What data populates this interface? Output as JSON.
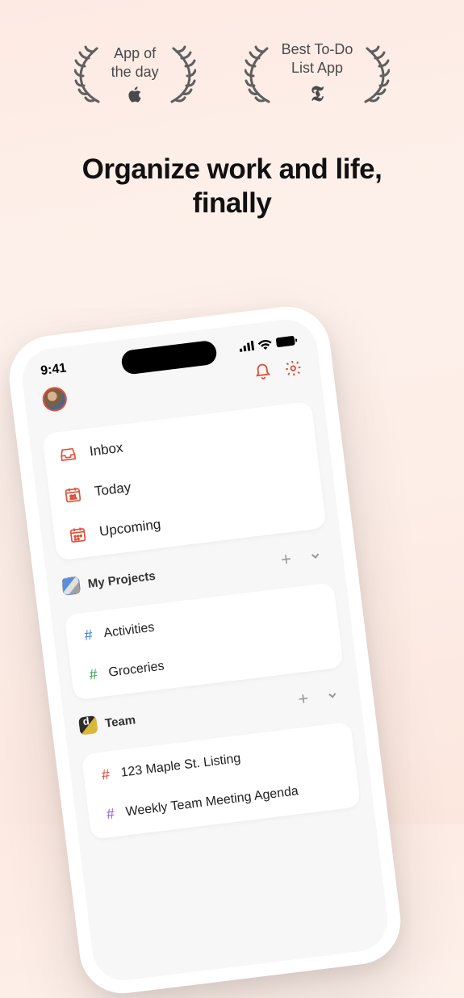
{
  "badges": {
    "left": {
      "line1": "App of",
      "line2": "the day"
    },
    "right": {
      "line1": "Best To-Do",
      "line2": "List App"
    }
  },
  "headline": {
    "line1": "Organize work and life,",
    "line2": "finally"
  },
  "phone": {
    "clock": "9:41",
    "nav": {
      "inbox": "Inbox",
      "today": "Today",
      "today_date": "21",
      "upcoming": "Upcoming"
    },
    "my_projects": {
      "title": "My Projects",
      "items": [
        {
          "name": "Activities",
          "color": "blue"
        },
        {
          "name": "Groceries",
          "color": "green"
        }
      ]
    },
    "team": {
      "title": "Team",
      "items": [
        {
          "name": "123 Maple St. Listing",
          "color": "red"
        },
        {
          "name": "Weekly Team Meeting Agenda",
          "color": "purple"
        }
      ]
    }
  },
  "colors": {
    "accent": "#e04f3a"
  }
}
